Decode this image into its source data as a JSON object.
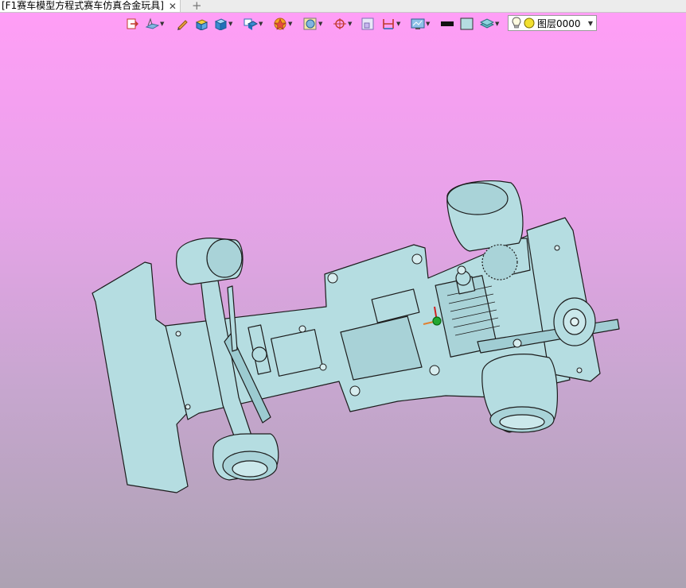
{
  "document_tab": {
    "title": "[F1赛车模型方程式赛车仿真合金玩具]",
    "close_glyph": "✕",
    "new_tab_glyph": "+"
  },
  "toolbar": {
    "items": [
      {
        "icon": "exit-sketch-icon"
      },
      {
        "icon": "sketch-plane-icon",
        "dropdown": true
      },
      {
        "icon": "pencil-icon"
      },
      {
        "icon": "box-solid-icon"
      },
      {
        "icon": "cube-shaded-icon",
        "dropdown": true
      },
      {
        "icon": "display-mode-icon",
        "dropdown": true
      },
      {
        "icon": "section-star-icon",
        "dropdown": true
      },
      {
        "icon": "render-style-icon",
        "dropdown": true
      },
      {
        "icon": "target-snap-icon",
        "dropdown": true
      },
      {
        "icon": "frame-select-icon"
      },
      {
        "icon": "measure-icon",
        "dropdown": true
      },
      {
        "icon": "view-screen-icon",
        "dropdown": true
      },
      {
        "icon": "line-color-swatch-icon"
      },
      {
        "icon": "fill-color-swatch-icon"
      },
      {
        "icon": "layer-stack-icon",
        "dropdown": true
      }
    ],
    "layer_selector": {
      "bulb_icon": "lightbulb-icon",
      "color_icon": "yellow-dot-icon",
      "value": "图层0000"
    }
  },
  "viewport": {
    "background_top": "#ff9ef6",
    "background_bottom": "#aca2b2",
    "model_color": "#b5dde1",
    "edge_color": "#1c1c1c"
  }
}
